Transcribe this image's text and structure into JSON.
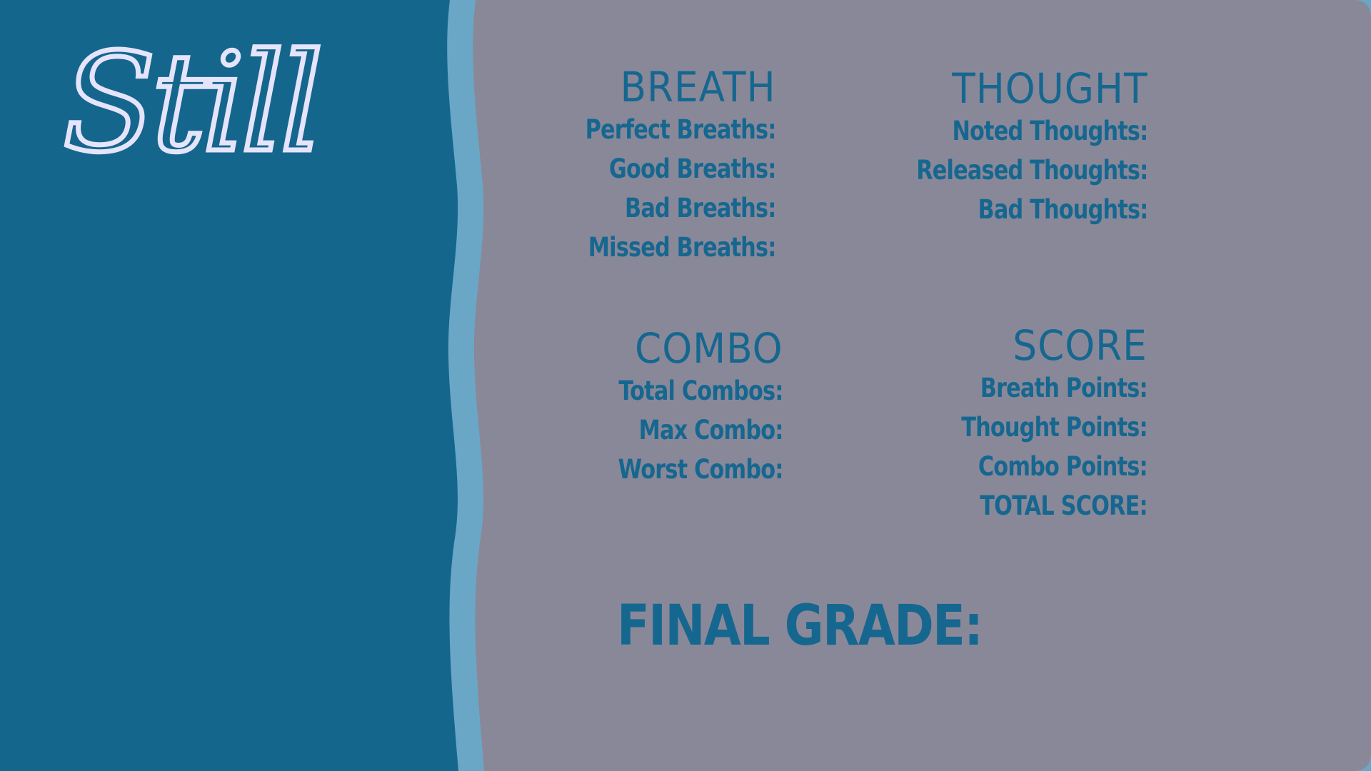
{
  "logo": {
    "text": "Still"
  },
  "colors": {
    "left_panel": "#15668d",
    "wave_stripe": "#6aa7c7",
    "right_panel": "#898899",
    "text": "#16678f",
    "logo": "#e6e4fb"
  },
  "breath": {
    "heading": "BREATH",
    "rows": [
      "Perfect Breaths:",
      "Good Breaths:",
      "Bad Breaths:",
      "Missed Breaths:"
    ]
  },
  "thought": {
    "heading": "THOUGHT",
    "rows": [
      "Noted Thoughts:",
      "Released Thoughts:",
      "Bad Thoughts:"
    ]
  },
  "combo": {
    "heading": "COMBO",
    "rows": [
      "Total Combos:",
      "Max Combo:",
      "Worst Combo:"
    ]
  },
  "score": {
    "heading": "SCORE",
    "rows": [
      "Breath Points:",
      "Thought Points:",
      "Combo Points:",
      "TOTAL SCORE:"
    ]
  },
  "final_grade": {
    "label": "FINAL GRADE:"
  }
}
